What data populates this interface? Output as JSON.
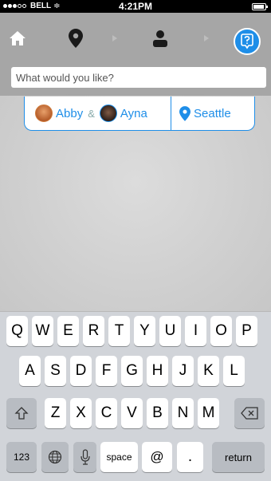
{
  "status_bar": {
    "carrier": "BELL",
    "time": "4:21PM",
    "battery_level": 0.95
  },
  "nav": {
    "icons": [
      "home-icon",
      "location-pin-icon",
      "chevron-right-icon",
      "person-icon",
      "chevron-right-icon",
      "help-icon"
    ]
  },
  "search": {
    "placeholder": "What would you like?",
    "value": ""
  },
  "context": {
    "person1": "Abby",
    "separator": "&",
    "person2": "Ayna",
    "place": "Seattle"
  },
  "colors": {
    "accent": "#1e8ee8",
    "nav_bg": "#a6a6a6",
    "keyboard_bg": "#d1d4d9"
  },
  "keyboard": {
    "row1": [
      "Q",
      "W",
      "E",
      "R",
      "T",
      "Y",
      "U",
      "I",
      "O",
      "P"
    ],
    "row2": [
      "A",
      "S",
      "D",
      "F",
      "G",
      "H",
      "J",
      "K",
      "L"
    ],
    "row3": [
      "Z",
      "X",
      "C",
      "V",
      "B",
      "N",
      "M"
    ],
    "row4": {
      "numbers": "123",
      "space": "space",
      "at": "@",
      "dot": ".",
      "return": "return"
    }
  }
}
